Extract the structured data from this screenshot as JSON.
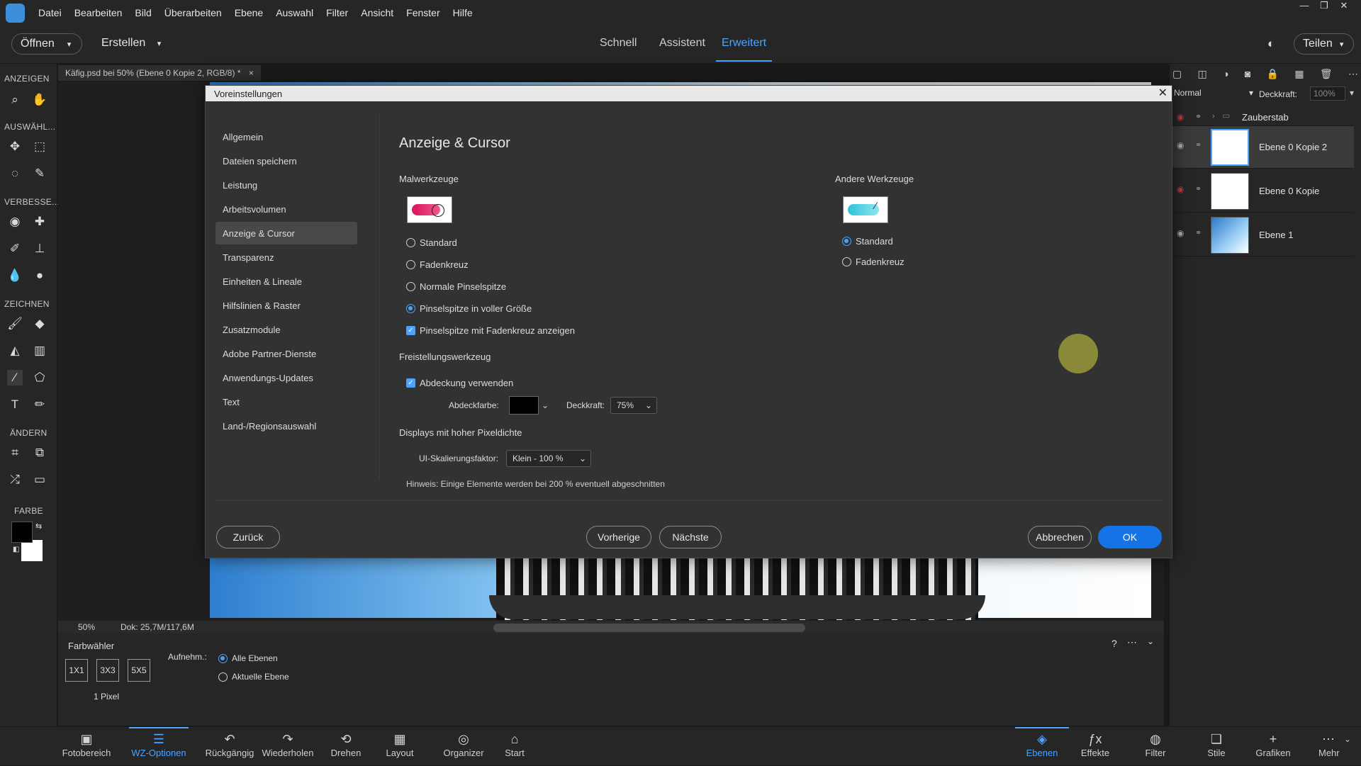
{
  "menubar": {
    "items": [
      "Datei",
      "Bearbeiten",
      "Bild",
      "Überarbeiten",
      "Ebene",
      "Auswahl",
      "Filter",
      "Ansicht",
      "Fenster",
      "Hilfe"
    ]
  },
  "modebar": {
    "open_label": "Öffnen",
    "create_label": "Erstellen",
    "tabs": [
      "Schnell",
      "Assistent",
      "Erweitert"
    ],
    "active_tab": "Erweitert",
    "share_label": "Teilen"
  },
  "tools": {
    "headers": [
      "ANZEIGEN",
      "AUSWÄHL...",
      "VERBESSE...",
      "ZEICHNEN",
      "ÄNDERN",
      "FARBE"
    ]
  },
  "document": {
    "tab_title": "Käfig.psd bei 50% (Ebene 0 Kopie 2, RGB/8) *",
    "zoom": "50%",
    "doc_size": "Dok: 25,7M/117,6M"
  },
  "layers_panel": {
    "blend_mode": "Normal",
    "opacity_label": "Deckkraft:",
    "opacity_value": "100%",
    "layers": [
      {
        "name": "Zauberstab"
      },
      {
        "name": "Ebene 0 Kopie 2"
      },
      {
        "name": "Ebene 0 Kopie"
      },
      {
        "name": "Ebene 1"
      }
    ]
  },
  "options": {
    "title": "Farbwähler",
    "sizes": [
      "1X1",
      "3X3",
      "5X5"
    ],
    "size_caption": "1 Pixel",
    "sample_label": "Aufnehm.:",
    "sample_options": [
      "Alle Ebenen",
      "Aktuelle Ebene"
    ]
  },
  "bottombar": {
    "left": [
      "Fotobereich",
      "WZ-Optionen",
      "Rückgängig",
      "Wiederholen",
      "Drehen",
      "Layout",
      "Organizer",
      "Start"
    ],
    "right": [
      "Ebenen",
      "Effekte",
      "Filter",
      "Stile",
      "Grafiken",
      "Mehr"
    ]
  },
  "dialog": {
    "title": "Voreinstellungen",
    "nav": [
      "Allgemein",
      "Dateien speichern",
      "Leistung",
      "Arbeitsvolumen",
      "Anzeige & Cursor",
      "Transparenz",
      "Einheiten & Lineale",
      "Hilfslinien & Raster",
      "Zusatzmodule",
      "Adobe Partner-Dienste",
      "Anwendungs-Updates",
      "Text",
      "Land-/Regionsauswahl"
    ],
    "active_nav": "Anzeige & Cursor",
    "heading": "Anzeige & Cursor",
    "painting": {
      "title": "Malwerkzeuge",
      "options": [
        "Standard",
        "Fadenkreuz",
        "Normale Pinselspitze",
        "Pinselspitze in voller Größe"
      ],
      "selected": "Pinselspitze in voller Größe",
      "checkbox": "Pinselspitze mit Fadenkreuz anzeigen"
    },
    "other": {
      "title": "Andere Werkzeuge",
      "options": [
        "Standard",
        "Fadenkreuz"
      ],
      "selected": "Standard"
    },
    "crop": {
      "title": "Freistellungswerkzeug",
      "checkbox": "Abdeckung verwenden",
      "color_label": "Abdeckfarbe:",
      "color_value": "#000000",
      "opacity_label": "Deckkraft:",
      "opacity_value": "75%"
    },
    "hidpi": {
      "title": "Displays mit hoher Pixeldichte",
      "scale_label": "UI-Skalierungsfaktor:",
      "scale_value": "Klein - 100 %",
      "hint": "Hinweis: Einige Elemente werden bei 200 % eventuell abgeschnitten"
    },
    "buttons": {
      "back": "Zurück",
      "prev": "Vorherige",
      "next": "Nächste",
      "cancel": "Abbrechen",
      "ok": "OK"
    }
  },
  "colors": {
    "accent": "#4aa3ff",
    "primary_button": "#1473e6"
  }
}
